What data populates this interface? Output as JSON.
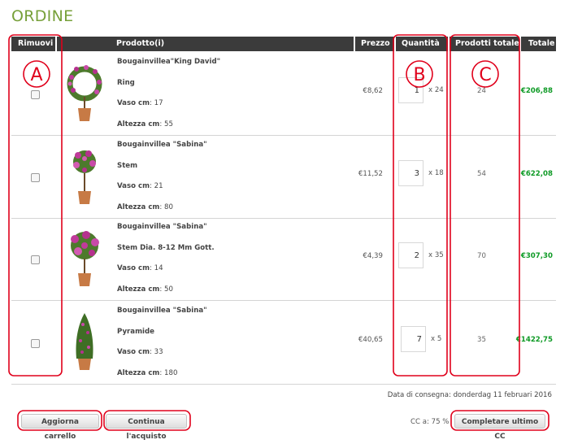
{
  "title": "ORDINE",
  "columns": {
    "remove": "Rimuovi",
    "product": "Prodotto(i)",
    "price": "Prezzo",
    "quantity": "Quantità",
    "total_products": "Prodotti totale",
    "total": "Totale"
  },
  "rows": [
    {
      "name": "Bougainvillea\"King David\"",
      "type": "Ring",
      "pot_label": "Vaso cm",
      "pot": ": 17",
      "height_label": "Altezza cm",
      "height": ": 55",
      "price": "€8,62",
      "qty": "1",
      "multiplier": "x 24",
      "total_products": "24",
      "total": "€206,88"
    },
    {
      "name": "Bougainvillea \"Sabina\"",
      "type": "Stem",
      "pot_label": "Vaso cm",
      "pot": ": 21",
      "height_label": "Altezza cm",
      "height": ": 80",
      "price": "€11,52",
      "qty": "3",
      "multiplier": "x 18",
      "total_products": "54",
      "total": "€622,08"
    },
    {
      "name": "Bougainvillea \"Sabina\"",
      "type": "Stem Dia. 8-12 Mm Gott.",
      "pot_label": "Vaso cm",
      "pot": ": 14",
      "height_label": "Altezza cm",
      "height": ": 50",
      "price": "€4,39",
      "qty": "2",
      "multiplier": "x 35",
      "total_products": "70",
      "total": "€307,30"
    },
    {
      "name": "Bougainvillea \"Sabina\"",
      "type": "Pyramide",
      "pot_label": "Vaso cm",
      "pot": ": 33",
      "height_label": "Altezza cm",
      "height": ": 180",
      "price": "€40,65",
      "qty": "7",
      "multiplier": "x 5",
      "total_products": "35",
      "total": "€1422,75"
    }
  ],
  "delivery": "Data di consegna: donderdag 11 februari 2016",
  "buttons": {
    "update": "Aggiorna carrello",
    "continue": "Continua l'acquisto",
    "complete": "Completare ultimo CC"
  },
  "cc_label": "CC a: 75 %",
  "annotations": {
    "a": "A",
    "b": "B",
    "c": "C"
  },
  "colors": {
    "title": "#77a03a",
    "total": "#0e9a25",
    "header": "#3b3b3b",
    "annotation": "#e0001b"
  }
}
